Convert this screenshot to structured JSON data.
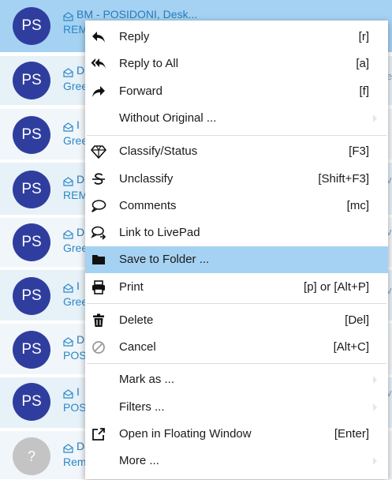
{
  "list": {
    "rows": [
      {
        "avatar": "PS",
        "sender": "BM - POSIDONI, Desk...",
        "subject": "REM",
        "right": "",
        "state": "selected"
      },
      {
        "avatar": "PS",
        "sender": "D",
        "subject": "Gree",
        "right": "e",
        "state": "normal"
      },
      {
        "avatar": "PS",
        "sender": "I",
        "subject": "Gree",
        "right": "",
        "state": "light"
      },
      {
        "avatar": "PS",
        "sender": "D",
        "subject": "REM",
        "right": "v",
        "state": "normal"
      },
      {
        "avatar": "PS",
        "sender": "D",
        "subject": "Gree",
        "right": "v",
        "state": "light"
      },
      {
        "avatar": "PS",
        "sender": "I",
        "subject": "Gree",
        "right": "v",
        "state": "normal"
      },
      {
        "avatar": "PS",
        "sender": "D",
        "subject": "POS",
        "right": "",
        "state": "light"
      },
      {
        "avatar": "PS",
        "sender": "I",
        "subject": "POS",
        "right": "v",
        "state": "normal"
      },
      {
        "avatar": "?",
        "sender": "D",
        "subject": "Rem",
        "right": "",
        "state": "light"
      }
    ]
  },
  "menu": {
    "items": [
      {
        "label": "Reply",
        "shortcut": "[r]",
        "icon": "reply-icon",
        "submenu": false,
        "highlighted": false
      },
      {
        "label": "Reply to All",
        "shortcut": "[a]",
        "icon": "reply-all-icon",
        "submenu": false,
        "highlighted": false
      },
      {
        "label": "Forward",
        "shortcut": "[f]",
        "icon": "forward-icon",
        "submenu": false,
        "highlighted": false
      },
      {
        "label": "Without Original ...",
        "shortcut": "",
        "icon": "",
        "submenu": true,
        "highlighted": false
      },
      {
        "label": "Classify/Status",
        "shortcut": "[F3]",
        "icon": "diamond-icon",
        "submenu": false,
        "highlighted": false
      },
      {
        "label": "Unclassify",
        "shortcut": "[Shift+F3]",
        "icon": "strikethrough-s-icon",
        "submenu": false,
        "highlighted": false
      },
      {
        "label": "Comments",
        "shortcut": "[mc]",
        "icon": "comment-icon",
        "submenu": false,
        "highlighted": false
      },
      {
        "label": "Link to LivePad",
        "shortcut": "",
        "icon": "livepad-link-icon",
        "submenu": false,
        "highlighted": false
      },
      {
        "label": "Save to Folder ...",
        "shortcut": "",
        "icon": "folder-icon",
        "submenu": false,
        "highlighted": true
      },
      {
        "label": "Print",
        "shortcut": "[p] or [Alt+P]",
        "icon": "printer-icon",
        "submenu": false,
        "highlighted": false
      },
      {
        "label": "Delete",
        "shortcut": "[Del]",
        "icon": "trash-icon",
        "submenu": false,
        "highlighted": false
      },
      {
        "label": "Cancel",
        "shortcut": "[Alt+C]",
        "icon": "cancel-icon",
        "submenu": false,
        "highlighted": false
      },
      {
        "label": "Mark as ...",
        "shortcut": "",
        "icon": "",
        "submenu": true,
        "highlighted": false
      },
      {
        "label": "Filters ...",
        "shortcut": "",
        "icon": "",
        "submenu": true,
        "highlighted": false
      },
      {
        "label": "Open in Floating Window",
        "shortcut": "[Enter]",
        "icon": "external-window-icon",
        "submenu": false,
        "highlighted": false
      },
      {
        "label": "More ...",
        "shortcut": "",
        "icon": "",
        "submenu": true,
        "highlighted": false
      }
    ]
  },
  "colors": {
    "highlight": "#a5d2f2",
    "avatar": "#2f3e9e",
    "avatar_unknown": "#c4c4c4",
    "link_text": "#2a88c8"
  }
}
